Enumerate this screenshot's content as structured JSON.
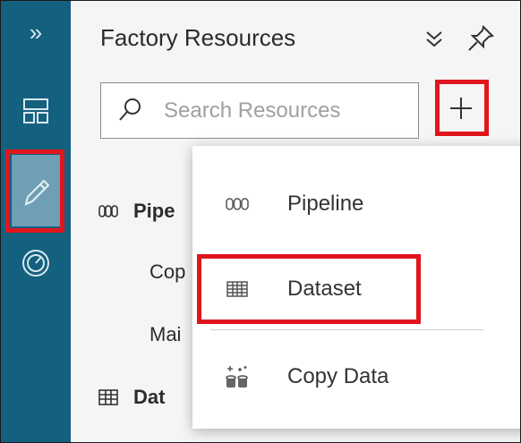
{
  "rail": {
    "items": [
      {
        "name": "expand",
        "icon": "chevrons-right-icon",
        "glyph": "»"
      },
      {
        "name": "overview",
        "icon": "dashboard-icon"
      },
      {
        "name": "author",
        "icon": "pencil-icon",
        "selected": true
      },
      {
        "name": "monitor",
        "icon": "gauge-icon"
      }
    ]
  },
  "panel": {
    "title": "Factory Resources",
    "search": {
      "placeholder": "Search Resources",
      "value": ""
    },
    "add_glyph": "+",
    "tree": {
      "pipelines_label": "Pipe",
      "pipeline_items": [
        "Cop",
        "Mai"
      ],
      "datasets_label": "Dat"
    }
  },
  "dropdown": {
    "items": [
      {
        "label": "Pipeline",
        "icon": "pipeline-icon"
      },
      {
        "label": "Dataset",
        "icon": "table-icon",
        "highlighted": true
      },
      {
        "label": "Copy Data",
        "icon": "copy-data-icon"
      }
    ]
  },
  "colors": {
    "rail": "#14607f",
    "rail_selected": "#6f9fb5",
    "highlight_box": "#e0161d",
    "panel_bg": "#f5f5f5"
  }
}
